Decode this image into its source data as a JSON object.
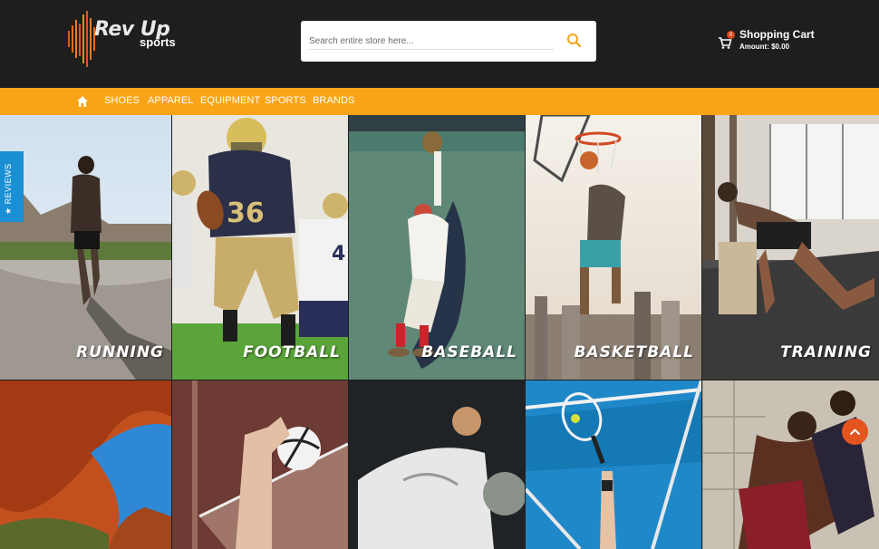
{
  "brand": {
    "logo_main": "Rev Up",
    "logo_sub": "sports"
  },
  "search": {
    "placeholder": "Search entire store here..."
  },
  "cart": {
    "title": "Shopping Cart",
    "amount": "Amount: $0.00",
    "count": "0"
  },
  "nav": {
    "items": [
      "SHOES",
      "APPAREL",
      "EQUIPMENT",
      "SPORTS",
      "BRANDS"
    ]
  },
  "tiles": [
    {
      "caption": "RUNNING"
    },
    {
      "caption": "FOOTBALL"
    },
    {
      "caption": "BASEBALL"
    },
    {
      "caption": "BASKETBALL"
    },
    {
      "caption": "TRAINING"
    },
    {
      "caption": ""
    },
    {
      "caption": ""
    },
    {
      "caption": ""
    },
    {
      "caption": ""
    },
    {
      "caption": ""
    }
  ],
  "reviews_tab": "★ REVIEWS",
  "colors": {
    "header_bg": "#1e1e1e",
    "nav_bg": "#f9a417",
    "reviews_tab": "#1b8fd4",
    "accent_orange": "#e4541f"
  }
}
